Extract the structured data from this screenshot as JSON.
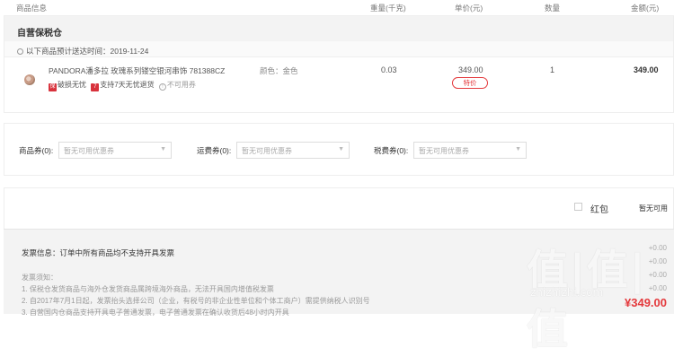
{
  "header": {
    "col_product": "商品信息",
    "col_weight": "重量(千克)",
    "col_unit_price": "单价(元)",
    "col_qty": "数量",
    "col_amount": "金额(元)"
  },
  "warehouse": {
    "name": "自营保税仓",
    "delivery_text": "以下商品预计送达时间：2019-11-24"
  },
  "item": {
    "name": "PANDORA潘多拉 玫瑰系列镂空银河串饰 781388CZ",
    "badges": [
      "破损无忧",
      "支持7天无忧退货",
      "不可用券"
    ],
    "color_attr": "颜色：金色",
    "weight": "0.03",
    "unit_price": "349.00",
    "special_tag": "特价",
    "qty": "1",
    "amount": "349.00"
  },
  "coupons": [
    {
      "label": "商品券(0):",
      "placeholder": "暂无可用优惠券"
    },
    {
      "label": "运费券(0):",
      "placeholder": "暂无可用优惠券"
    },
    {
      "label": "税费券(0):",
      "placeholder": "暂无可用优惠券"
    }
  ],
  "redpacket": {
    "label": "红包",
    "status": "暂无可用"
  },
  "invoice": {
    "info": "发票信息：订单中所有商品均不支持开具发票",
    "notes_title": "发票须知：",
    "notes": [
      "1. 保税仓发货商品与海外仓发货商品属跨境海外商品，无法开具国内增值税发票",
      "2. 自2017年7月1日起，发票抬头选择公司（企业，有税号的非企业性单位和个体工商户）需提供纳税人识别号",
      "3. 自营国内仓商品支持开具电子普通发票，电子普通发票在确认收货后48小时内开具"
    ]
  },
  "summary": {
    "values": [
      "+0.00",
      "+0.00",
      "+0.00",
      "+0.00"
    ],
    "total": "¥349.00"
  },
  "watermark": {
    "big": "值|值|值",
    "small": "zhizhizhi.com"
  }
}
